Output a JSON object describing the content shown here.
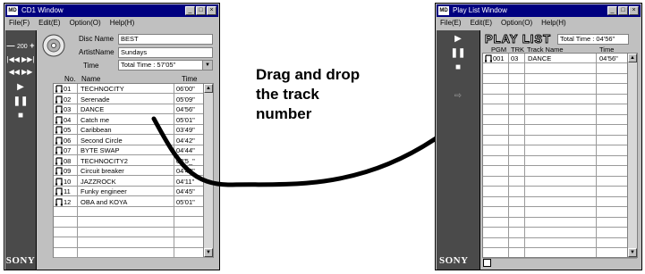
{
  "cd_window": {
    "title": "CD1 Window",
    "app_icon": "MD",
    "menus": [
      "File(F)",
      "Edit(E)",
      "Option(O)",
      "Help(H)"
    ],
    "volume": "200",
    "disc_name_label": "Disc Name",
    "disc_name": "BEST",
    "artist_name_label": "ArtistName",
    "artist_name": "Sundays",
    "time_label": "Time",
    "time_value": "Total Time : 57'05\"",
    "col_no": "No.",
    "col_name": "Name",
    "col_time": "Time",
    "tracks": [
      {
        "no": "01",
        "name": "TECHNOCITY",
        "time": "06'00\""
      },
      {
        "no": "02",
        "name": "Serenade",
        "time": "05'09\""
      },
      {
        "no": "03",
        "name": "DANCE",
        "time": "04'56\""
      },
      {
        "no": "04",
        "name": "Catch me",
        "time": "05'01\""
      },
      {
        "no": "05",
        "name": "Caribbean",
        "time": "03'49\""
      },
      {
        "no": "06",
        "name": "Second Circle",
        "time": "04'42\""
      },
      {
        "no": "07",
        "name": "BYTE SWAP",
        "time": "04'44\""
      },
      {
        "no": "08",
        "name": "TECHNOCITY2",
        "time": "03'5_\""
      },
      {
        "no": "09",
        "name": "Circuit breaker",
        "time": "04'49\""
      },
      {
        "no": "10",
        "name": "JAZZROCK",
        "time": "04'11\""
      },
      {
        "no": "11",
        "name": "Funky engineer",
        "time": "04'45\""
      },
      {
        "no": "12",
        "name": "OBA and KOYA",
        "time": "05'01\""
      }
    ],
    "brand": "SONY"
  },
  "playlist_window": {
    "title": "Play List Window",
    "app_icon": "MD",
    "menus": [
      "File(E)",
      "Edit(E)",
      "Option(O)",
      "Help(H)"
    ],
    "heading": "PLAY LIST",
    "total_time": "Total Time : 04'56\"",
    "col_pgm": "PGM",
    "col_trk": "TRK",
    "col_track_name": "Track Name",
    "col_time": "Time",
    "entries": [
      {
        "pgm": "001",
        "trk": "03",
        "name": "DANCE",
        "time": "04'56\""
      }
    ],
    "brand": "SONY"
  },
  "instruction": {
    "line1": "Drag and drop",
    "line2": "the track",
    "line3": "number"
  }
}
